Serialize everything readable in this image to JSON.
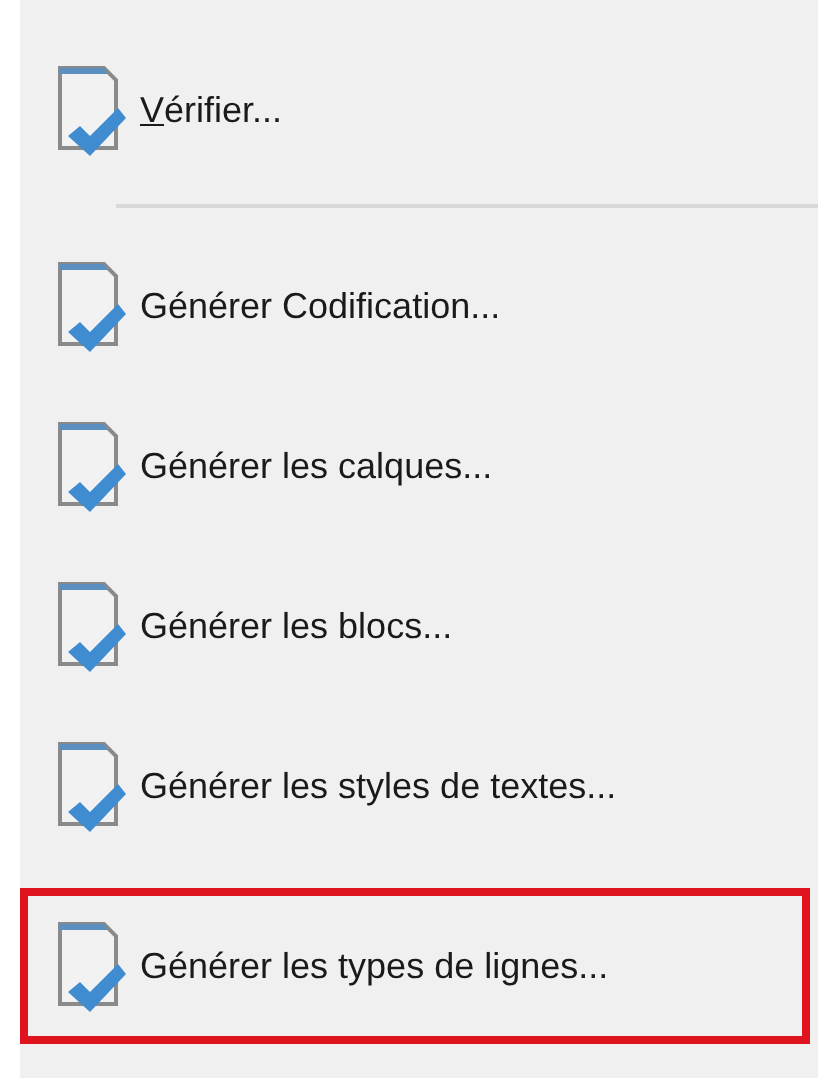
{
  "menu": {
    "items": [
      {
        "kind": "command",
        "label": "Vérifier...",
        "underline_first_letter": true,
        "selected": false
      },
      {
        "kind": "separator"
      },
      {
        "kind": "command",
        "label": "Générer Codification...",
        "underline_first_letter": false,
        "selected": false
      },
      {
        "kind": "command",
        "label": "Générer les calques...",
        "underline_first_letter": false,
        "selected": false
      },
      {
        "kind": "command",
        "label": "Générer les blocs...",
        "underline_first_letter": false,
        "selected": false
      },
      {
        "kind": "command",
        "label": "Générer les styles de textes...",
        "underline_first_letter": false,
        "selected": false
      },
      {
        "kind": "command",
        "label": "Générer les types de lignes...",
        "underline_first_letter": false,
        "selected": true
      }
    ]
  }
}
